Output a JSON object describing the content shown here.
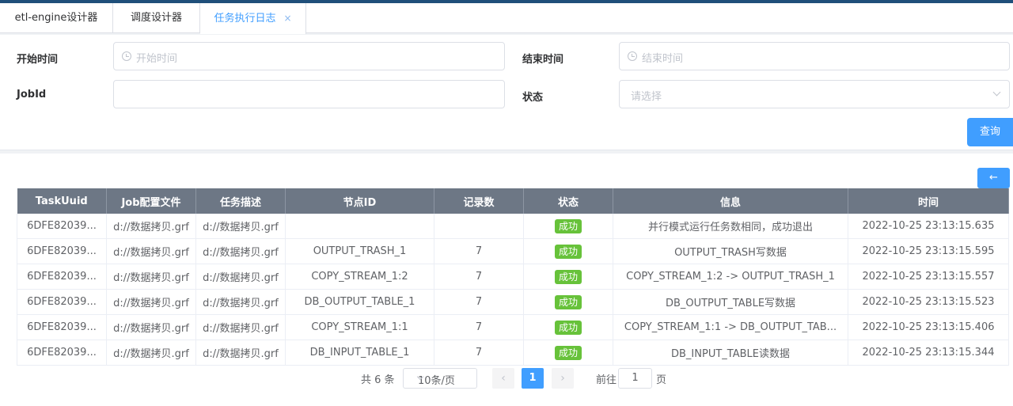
{
  "tabs": [
    {
      "label": "etl-engine设计器"
    },
    {
      "label": "调度设计器"
    },
    {
      "label": "任务执行日志",
      "close": "×"
    }
  ],
  "form": {
    "start_label": "开始时间",
    "start_placeholder": "开始时间",
    "end_label": "结束时间",
    "end_placeholder": "结束时间",
    "jobid_label": "JobId",
    "jobid_value": "",
    "status_label": "状态",
    "status_placeholder": "请选择",
    "query_label": "查询"
  },
  "back_label": "←",
  "table": {
    "columns": [
      "TaskUuid",
      "Job配置文件",
      "任务描述",
      "节点ID",
      "记录数",
      "状态",
      "信息",
      "时间"
    ],
    "rows": [
      [
        "6DFE82039...",
        "d://数据拷贝.grf",
        "d://数据拷贝.grf",
        "",
        "",
        "成功",
        "并行模式运行任务数相同，成功退出",
        "2022-10-25 23:13:15.635"
      ],
      [
        "6DFE82039...",
        "d://数据拷贝.grf",
        "d://数据拷贝.grf",
        "OUTPUT_TRASH_1",
        "7",
        "成功",
        "OUTPUT_TRASH写数据",
        "2022-10-25 23:13:15.595"
      ],
      [
        "6DFE82039...",
        "d://数据拷贝.grf",
        "d://数据拷贝.grf",
        "COPY_STREAM_1:2",
        "7",
        "成功",
        "COPY_STREAM_1:2 -> OUTPUT_TRASH_1",
        "2022-10-25 23:13:15.557"
      ],
      [
        "6DFE82039...",
        "d://数据拷贝.grf",
        "d://数据拷贝.grf",
        "DB_OUTPUT_TABLE_1",
        "7",
        "成功",
        "DB_OUTPUT_TABLE写数据",
        "2022-10-25 23:13:15.523"
      ],
      [
        "6DFE82039...",
        "d://数据拷贝.grf",
        "d://数据拷贝.grf",
        "COPY_STREAM_1:1",
        "7",
        "成功",
        "COPY_STREAM_1:1 -> DB_OUTPUT_TAB...",
        "2022-10-25 23:13:15.406"
      ],
      [
        "6DFE82039...",
        "d://数据拷贝.grf",
        "d://数据拷贝.grf",
        "DB_INPUT_TABLE_1",
        "7",
        "成功",
        "DB_INPUT_TABLE读数据",
        "2022-10-25 23:13:15.344"
      ]
    ]
  },
  "pager": {
    "total": "共 6 条",
    "page_size": "10条/页",
    "prev": "‹",
    "current": "1",
    "next": "›",
    "goto": "前往",
    "jump_value": "1",
    "page_suffix": "页"
  }
}
